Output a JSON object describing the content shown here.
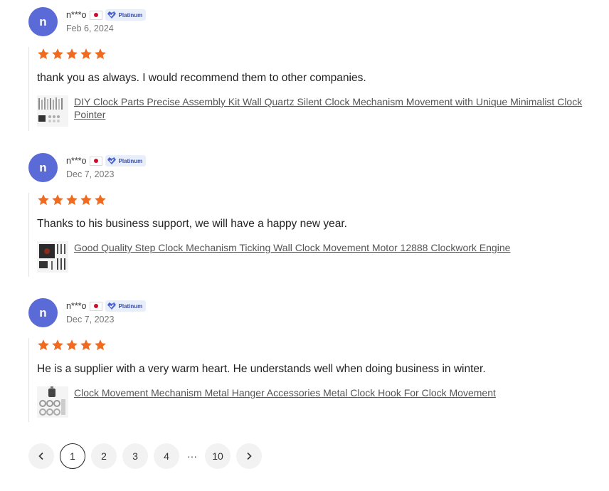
{
  "reviews": [
    {
      "avatar_letter": "n",
      "username": "n***o",
      "badge": "Platinum",
      "date": "Feb 6, 2024",
      "rating": 5,
      "text": "thank you as always. I would recommend them to other companies.",
      "product": "DIY Clock Parts Precise Assembly Kit Wall Quartz Silent Clock Mechanism Movement with Unique Minimalist Clock Pointer"
    },
    {
      "avatar_letter": "n",
      "username": "n***o",
      "badge": "Platinum",
      "date": "Dec 7, 2023",
      "rating": 5,
      "text": "Thanks to his business support, we will have a happy new year.",
      "product": "Good Quality Step Clock Mechanism Ticking Wall Clock Movement Motor 12888 Clockwork Engine"
    },
    {
      "avatar_letter": "n",
      "username": "n***o",
      "badge": "Platinum",
      "date": "Dec 7, 2023",
      "rating": 5,
      "text": "He is a supplier with a very warm heart. He understands well when doing business in winter.",
      "product": "Clock Movement Mechanism Metal Hanger Accessories Metal Clock Hook For Clock Movement"
    }
  ],
  "pagination": {
    "prev_icon": "chevron-left-icon",
    "pages": [
      "1",
      "2",
      "3",
      "4"
    ],
    "ellipsis": "···",
    "last_page": "10",
    "next_icon": "chevron-right-icon",
    "current": "1"
  },
  "colors": {
    "star": "#f06a1f",
    "avatar": "#5a6ad6",
    "badge_bg": "#e9eefb",
    "badge_icon": "#4a63d3"
  }
}
